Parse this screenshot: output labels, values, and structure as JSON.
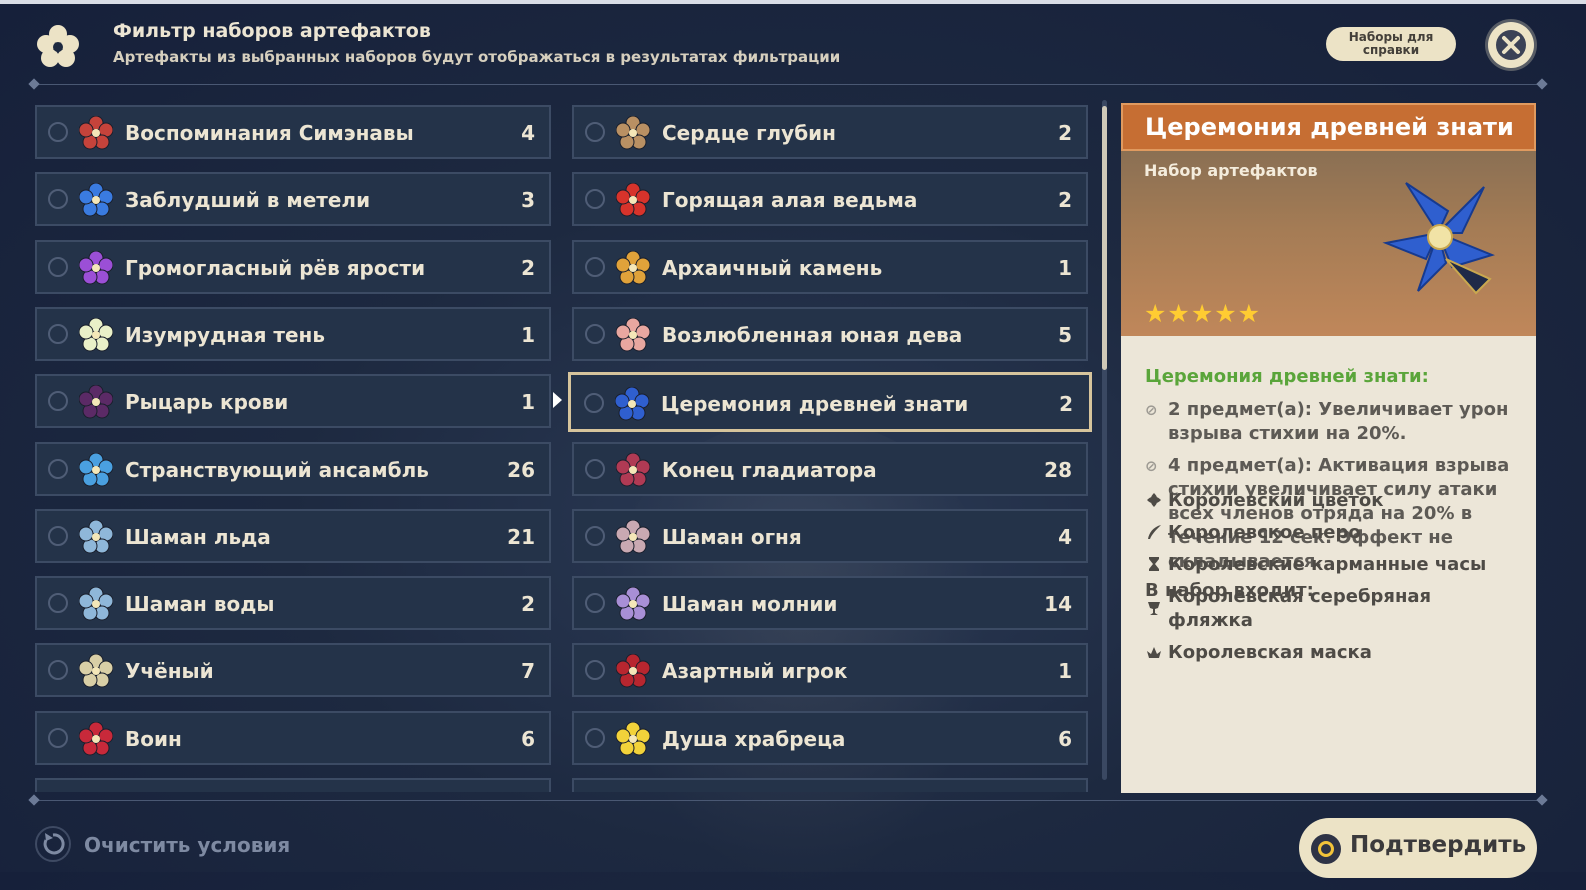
{
  "header": {
    "title": "Фильтр наборов артефактов",
    "subtitle": "Артефакты из выбранных наборов будут отображаться в результатах фильтрации",
    "reference_button": "Наборы для справки"
  },
  "left_column": [
    {
      "name": "Воспоминания Симэнавы",
      "count": "4",
      "icon": "shimenawa-icon",
      "color": "#c5433b"
    },
    {
      "name": "Заблудший в метели",
      "count": "3",
      "icon": "blizzard-icon",
      "color": "#3a7be0"
    },
    {
      "name": "Громогласный рёв ярости",
      "count": "2",
      "icon": "thundering-fury-icon",
      "color": "#9b4fd6"
    },
    {
      "name": "Изумрудная тень",
      "count": "1",
      "icon": "viridescent-icon",
      "color": "#e9f0c8"
    },
    {
      "name": "Рыцарь крови",
      "count": "1",
      "icon": "bloodstained-icon",
      "color": "#5b2a66"
    },
    {
      "name": "Странствующий ансамбль",
      "count": "26",
      "icon": "troupe-icon",
      "color": "#4aa0e0"
    },
    {
      "name": "Шаман льда",
      "count": "21",
      "icon": "ice-shaman-icon",
      "color": "#8fb7d9"
    },
    {
      "name": "Шаман воды",
      "count": "2",
      "icon": "water-shaman-icon",
      "color": "#8fb7d9"
    },
    {
      "name": "Учёный",
      "count": "7",
      "icon": "scholar-icon",
      "color": "#d9cfa6"
    },
    {
      "name": "Воин",
      "count": "6",
      "icon": "warrior-icon",
      "color": "#c8293a"
    }
  ],
  "right_column": [
    {
      "name": "Сердце глубин",
      "count": "2",
      "icon": "heart-of-depth-icon",
      "color": "#b99063"
    },
    {
      "name": "Горящая алая ведьма",
      "count": "2",
      "icon": "crimson-witch-icon",
      "color": "#d7332b"
    },
    {
      "name": "Архаичный камень",
      "count": "1",
      "icon": "archaic-petra-icon",
      "color": "#e0a23a"
    },
    {
      "name": "Возлюбленная юная дева",
      "count": "5",
      "icon": "maiden-icon",
      "color": "#e8a7a0"
    },
    {
      "name": "Церемония древней знати",
      "count": "2",
      "icon": "noblesse-icon",
      "color": "#2f5fcf"
    },
    {
      "name": "Конец гладиатора",
      "count": "28",
      "icon": "gladiator-icon",
      "color": "#b03a54"
    },
    {
      "name": "Шаман огня",
      "count": "4",
      "icon": "fire-shaman-icon",
      "color": "#c9a9b2"
    },
    {
      "name": "Шаман молнии",
      "count": "14",
      "icon": "lightning-shaman-icon",
      "color": "#a88fd6"
    },
    {
      "name": "Азартный игрок",
      "count": "1",
      "icon": "gambler-icon",
      "color": "#b8262f"
    },
    {
      "name": "Душа храбреца",
      "count": "6",
      "icon": "brave-heart-icon",
      "color": "#f2d23a"
    }
  ],
  "selected_index": 4,
  "panel": {
    "title": "Церемония древней знати",
    "type": "Набор артефактов",
    "stars": "★★★★★",
    "set_label": "Церемония древней знати:",
    "bonus_2": "2 предмет(а): Увеличивает урон взрыва стихии на 20%.",
    "bonus_4": "4 предмет(а): Активация взрыва стихии увеличивает силу атаки всех членов отряда на 20% в течение 12 сек. Эффект не складывается.",
    "includes_label": "В набор входит:",
    "pieces": [
      {
        "name": "Королевский цветок",
        "icon": "flower-icon"
      },
      {
        "name": "Королевское перо",
        "icon": "feather-icon"
      },
      {
        "name": "Королевские карманные часы",
        "icon": "hourglass-icon"
      },
      {
        "name": "Королевская серебряная фляжка",
        "icon": "goblet-icon"
      },
      {
        "name": "Королевская маска",
        "icon": "circlet-icon"
      }
    ]
  },
  "footer": {
    "clear_label": "Очистить условия",
    "confirm_label": "Подтвердить"
  },
  "colors": {
    "accent": "#d6c49c",
    "panel_title_bg": "#c66e33",
    "set_label": "#5aa53a",
    "star": "#ffcc32"
  }
}
